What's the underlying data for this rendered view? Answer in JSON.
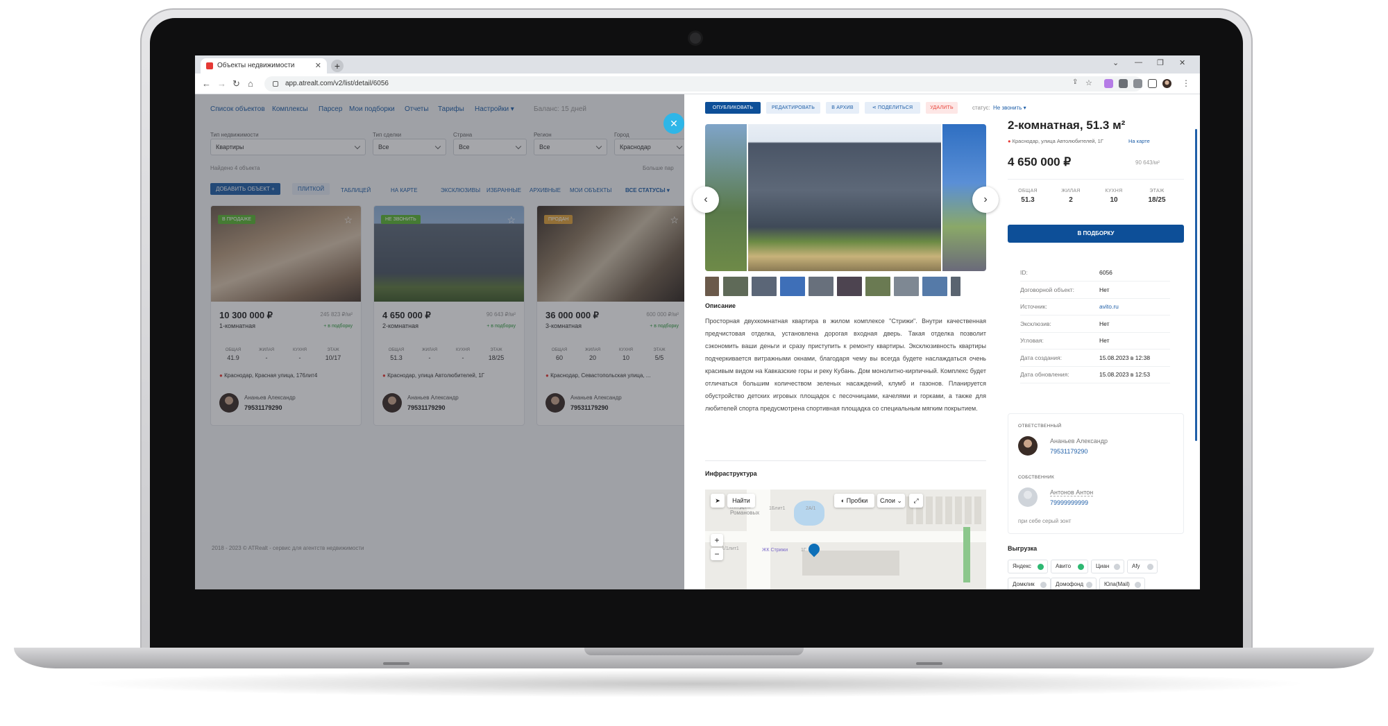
{
  "browser": {
    "tab_title": "Объекты недвижимости",
    "tab_close": "✕",
    "new_tab": "+",
    "url": "app.atrealt.com/v2/list/detail/6056",
    "win_min": "⌄",
    "win_dash": "—",
    "win_max": "❐",
    "win_close": "✕"
  },
  "topnav": {
    "items": [
      "Список объектов",
      "Комплексы",
      "Парсер",
      "Мои подборки",
      "Отчеты",
      "Тарифы",
      "Настройки ▾"
    ],
    "balance": "Баланс: 15 дней"
  },
  "filters": {
    "property_type_label": "Тип недвижимости",
    "property_type_value": "Квартиры",
    "deal_type_label": "Тип сделки",
    "deal_type_value": "Все",
    "country_label": "Страна",
    "country_value": "Все",
    "region_label": "Регион",
    "region_value": "Все",
    "city_label": "Город",
    "city_value": "Краснодар",
    "found": "Найдено 4 объекта",
    "more": "Больше пар"
  },
  "view_tabs": {
    "add_object": "ДОБАВИТЬ ОБЪЕКТ +",
    "tiles": "ПЛИТКОЙ",
    "table": "ТАБЛИЦЕЙ",
    "map": "НА КАРТЕ",
    "exclusive": "ЭКСКЛЮЗИВЫ",
    "favorites": "ИЗБРАННЫЕ",
    "archived": "АРХИВНЫЕ",
    "mine": "МОИ ОБЪЕКТЫ",
    "all_statuses": "ВСЕ СТАТУСЫ ▾"
  },
  "stat_labels": {
    "total": "ОБЩАЯ",
    "living": "ЖИЛАЯ",
    "kitchen": "КУХНЯ",
    "floor": "ЭТАЖ"
  },
  "cards": [
    {
      "badge": "В ПРОДАЖЕ",
      "price": "10 300 000 ₽",
      "ppm": "245 823 ₽/м²",
      "rooms": "1-комнатная",
      "add": "+ в подборку",
      "total": "41.9",
      "living": "-",
      "kitchen": "-",
      "floor": "10/17",
      "address": "Краснодар, Красная улица, 176лит4",
      "agent": "Ананьев Александр",
      "phone": "79531179290",
      "badge_color": "#5bb532"
    },
    {
      "badge": "НЕ ЗВОНИТЬ",
      "price": "4 650 000 ₽",
      "ppm": "90 643 ₽/м²",
      "rooms": "2-комнатная",
      "add": "+ в подборку",
      "total": "51.3",
      "living": "-",
      "kitchen": "-",
      "floor": "18/25",
      "address": "Краснодар, улица Автолюбителей, 1Г",
      "agent": "Ананьев Александр",
      "phone": "79531179290",
      "badge_color": "#5bb532"
    },
    {
      "badge": "ПРОДАН",
      "price": "36 000 000 ₽",
      "ppm": "600 000 ₽/м²",
      "rooms": "3-комнатная",
      "add": "+ в подборку",
      "total": "60",
      "living": "20",
      "kitchen": "10",
      "floor": "5/5",
      "address": "Краснодар, Севастопольская улица, ...",
      "agent": "Ананьев Александр",
      "phone": "79531179290",
      "badge_color": "#e0a33a"
    }
  ],
  "footer": "2018 - 2023 © ATRealt - сервис для агентств недвижимости",
  "detail": {
    "actions": {
      "publish": "ОПУБЛИКОВАТЬ",
      "edit": "РЕДАКТИРОВАТЬ",
      "archive": "В АРХИВ",
      "share": "ПОДЕЛИТЬСЯ",
      "delete": "УДАЛИТЬ",
      "status_label": "статус:",
      "status_value": "Не звонить ▾"
    },
    "title": "2-комнатная, 51.3 м²",
    "address": "Краснодар, улица Автолюбителей, 1Г",
    "on_map": "На карте",
    "price": "4 650 000 ₽",
    "price_per_m2": "90 643/м²",
    "stats": {
      "total": "51.3",
      "living": "2",
      "kitchen": "10",
      "floor": "18/25"
    },
    "stat_labels": {
      "total": "ОБЩАЯ",
      "living": "ЖИЛАЯ",
      "kitchen": "КУХНЯ",
      "floor": "ЭТАЖ"
    },
    "to_selection": "В ПОДБОРКУ",
    "props": [
      {
        "k": "ID:",
        "v": "6056"
      },
      {
        "k": "Договорной объект:",
        "v": "Нет"
      },
      {
        "k": "Источник:",
        "v": "avito.ru"
      },
      {
        "k": "Эксклюзив:",
        "v": "Нет"
      },
      {
        "k": "Угловая:",
        "v": "Нет"
      },
      {
        "k": "Дата создания:",
        "v": "15.08.2023 в 12:38"
      },
      {
        "k": "Дата обновления:",
        "v": "15.08.2023 в 12:53"
      }
    ],
    "responsible_label": "ОТВЕТСТВЕННЫЙ",
    "responsible_name": "Ананьев Александр",
    "responsible_phone": "79531179290",
    "owner_label": "СОБСТВЕННИК",
    "owner_name": "Антонов Антон",
    "owner_phone": "79999999999",
    "owner_note": "при себе серый зонт",
    "description_title": "Описание",
    "description": "Просторная двухкомнатная квартира в жилом комплексе \"Стрижи\". Внутри качественная предчистовая отделка, установлена дорогая входная дверь. Такая отделка позволит сэкономить ваши деньги и сразу приступить к ремонту квартиры. Эксклюзивность квартиры подчеркивается витражными окнами, благодаря чему вы всегда будете наслаждаться очень красивым видом на Кавказские горы и реку Кубань. Дом монолитно-кирпичный. Комплекс будет отличаться большим количеством зеленых насаждений, клумб и газонов. Планируется обустройство детских игровых площадок с песочницами, качелями и горками, а также для любителей спорта предусмотрена спортивная площадка со специальным мягким покрытием.",
    "infra_title": "Инфраструктура",
    "map": {
      "find": "Найти",
      "traffic": "Пробки",
      "layers": "Слои ⌄",
      "zoom_in": "+",
      "zoom_out": "−",
      "label_complex": "ЖК Дом Романовых",
      "label_strizhi": "ЖК Стрижи",
      "label_1": "1Блит1",
      "label_2": "2А/1",
      "label_3": "1/1лит1",
      "label_4": "1Г"
    },
    "export_title": "Выгрузка",
    "exports": [
      {
        "name": "Яндекс",
        "on": true
      },
      {
        "name": "Авито",
        "on": true
      },
      {
        "name": "Циан",
        "on": false
      },
      {
        "name": "Afy",
        "on": false
      },
      {
        "name": "Домклик",
        "on": false
      },
      {
        "name": "Домофонд",
        "on": false
      },
      {
        "name": "Юла(Mail)",
        "on": false
      }
    ]
  },
  "colors": {
    "accent": "#1f5fa8",
    "primary_btn": "#0d4f98",
    "delete": "#e8453c",
    "ok": "#2eb872",
    "close": "#2eb6e8"
  }
}
